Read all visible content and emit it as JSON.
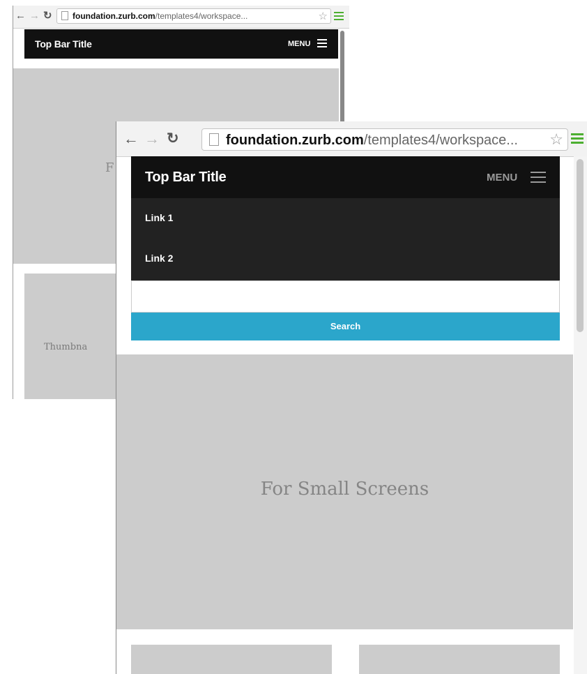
{
  "back_window": {
    "browser": {
      "url_host": "foundation.zurb.com",
      "url_path": "/templates4/workspace...",
      "icons": [
        "back-arrow-icon",
        "forward-arrow-icon",
        "reload-icon",
        "page-icon",
        "bookmark-star-icon",
        "chrome-menu-icon"
      ]
    },
    "topbar": {
      "title": "Top Bar Title",
      "menu_label": "MENU"
    },
    "hero_text_partial": "F",
    "thumbnail_text_partial": "Thumbna"
  },
  "front_window": {
    "browser": {
      "url_host": "foundation.zurb.com",
      "url_path": "/templates4/workspace...",
      "icons": [
        "back-arrow-icon",
        "forward-arrow-icon",
        "reload-icon",
        "page-icon",
        "bookmark-star-icon",
        "chrome-menu-icon"
      ]
    },
    "topbar": {
      "title": "Top Bar Title",
      "menu_label": "MENU"
    },
    "dropdown": {
      "links": [
        {
          "label": "Link 1"
        },
        {
          "label": "Link 2"
        }
      ]
    },
    "search": {
      "input_value": "",
      "button_label": "Search"
    },
    "hero_text": "For Small Screens"
  },
  "colors": {
    "topbar_bg": "#111111",
    "dropdown_bg": "#222222",
    "search_button_bg": "#2ba6cb",
    "placeholder_bg": "#cccccc",
    "chrome_menu_green": "#4caf30"
  }
}
